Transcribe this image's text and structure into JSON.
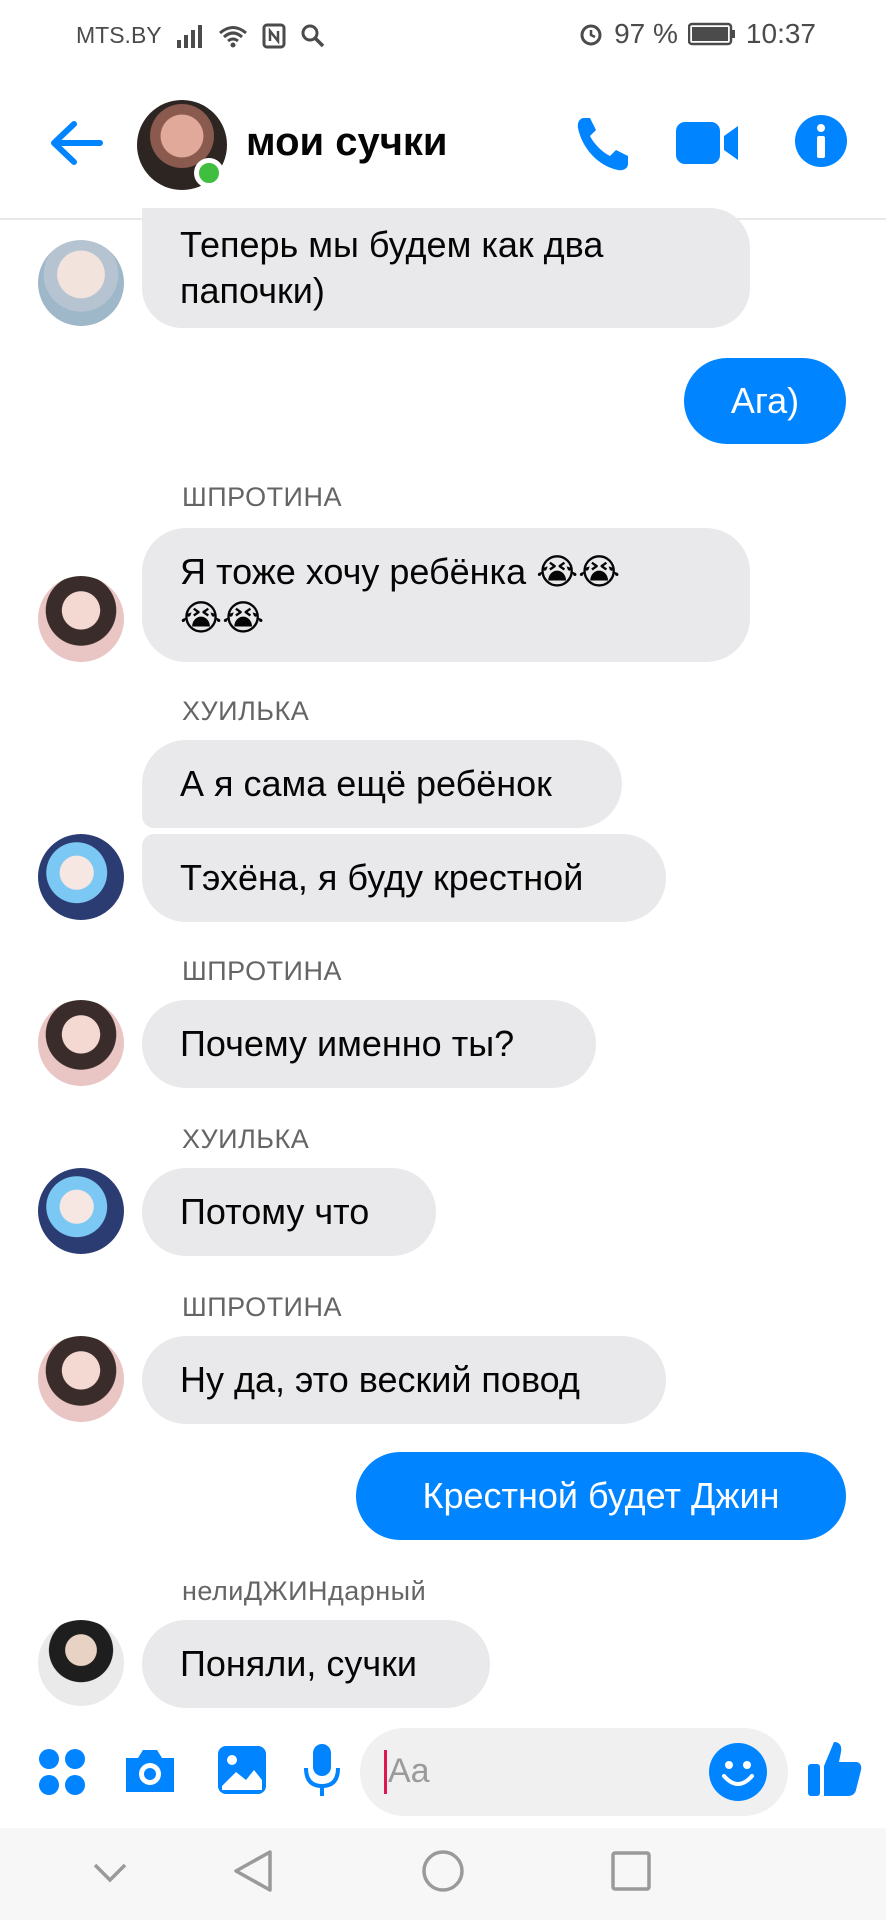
{
  "status_bar": {
    "carrier": "MTS.BY",
    "battery": "97 %",
    "time": "10:37"
  },
  "header": {
    "title": "мои сучки"
  },
  "messages": [
    {
      "text_line1": "Теперь мы будем как два",
      "text_line2": "папочки)"
    },
    {
      "text": "Ага)"
    },
    {
      "sender": "ШПРОТИНА",
      "text_line1": "Я тоже хочу ребёнка 😭😭",
      "text_line2": "😭😭"
    },
    {
      "sender": "ХУИЛЬКА",
      "text": "А я сама ещё ребёнок"
    },
    {
      "text": "Тэхёна, я буду крестной"
    },
    {
      "sender": "ШПРОТИНА",
      "text": "Почему именно ты?"
    },
    {
      "sender": "ХУИЛЬКА",
      "text": "Потому что"
    },
    {
      "sender": "ШПРОТИНА",
      "text": "Ну да, это веский повод"
    },
    {
      "text": "Крестной будет Джин"
    },
    {
      "sender": "нелиДЖИНдарный",
      "text": "Поняли, сучки"
    }
  ],
  "composer": {
    "placeholder": "Aa"
  },
  "colors": {
    "accent": "#0084ff",
    "incoming_bubble": "#e9e9eb",
    "online": "#3fbe3f"
  },
  "icons": [
    "back-arrow-icon",
    "phone-icon",
    "video-icon",
    "info-icon",
    "apps-icon",
    "camera-icon",
    "gallery-icon",
    "mic-icon",
    "emoji-icon",
    "like-icon",
    "nav-down-icon",
    "nav-back-icon",
    "nav-home-icon",
    "nav-recents-icon"
  ]
}
